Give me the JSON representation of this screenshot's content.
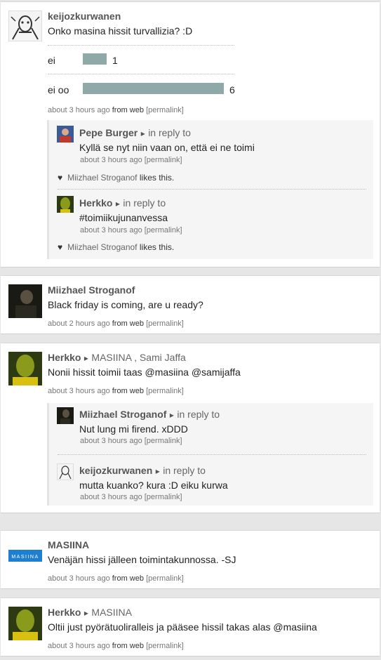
{
  "posts": [
    {
      "author": "keijozkurwanen",
      "text": "Onko masina hissit turvallizia? :D",
      "poll": {
        "options": [
          {
            "label": "ei",
            "count": "1",
            "share": 0.167
          },
          {
            "label": "ei oo",
            "count": "6",
            "share": 1.0
          }
        ]
      },
      "meta": {
        "time": "about 3 hours ago",
        "from": "from web",
        "permalink": "[permalink]"
      },
      "replies": [
        {
          "author": "Pepe Burger",
          "arrow": "▸",
          "in_reply": "in reply to",
          "text": "Kyllä se nyt niin vaan on, että ei ne toimi",
          "time": "about 3 hours ago",
          "permalink": "[permalink]",
          "like_user": "Miizhael Stroganof",
          "likes_word": "likes this."
        },
        {
          "author": "Herkko",
          "arrow": "▸",
          "in_reply": "in reply to",
          "text": "#toimiikujunanvessa",
          "time": "about 3 hours ago",
          "permalink": "[permalink]",
          "like_user": "Miizhael Stroganof",
          "likes_word": "likes this."
        }
      ]
    },
    {
      "author": "Miizhael Stroganof",
      "text": "Black friday is coming, are u ready?",
      "meta": {
        "time": "about 2 hours ago",
        "from": "from web",
        "permalink": "[permalink]"
      }
    },
    {
      "author": "Herkko",
      "arrow": "▸",
      "recipients": "MASIINA , Sami Jaffa",
      "text": "Nonii hissit toimii taas @masiina @samijaffa",
      "meta": {
        "time": "about 3 hours ago",
        "from": "from web",
        "permalink": "[permalink]"
      },
      "replies": [
        {
          "author": "Miizhael Stroganof",
          "arrow": "▸",
          "in_reply": "in reply to",
          "text": "Nut lung mi firend. xDDD",
          "time": "about 3 hours ago",
          "permalink": "[permalink]"
        },
        {
          "author": "keijozkurwanen",
          "arrow": "▸",
          "in_reply": "in reply to",
          "text": "mutta kuanko? kura :D eiku kurwa",
          "time": "about 3 hours ago",
          "permalink": "[permalink]"
        }
      ]
    },
    {
      "author": "MASIINA",
      "logo_text": "MASIINA",
      "text": "Venäjän hissi jälleen toimintakunnossa. -SJ",
      "meta": {
        "time": "about 3 hours ago",
        "from": "from web",
        "permalink": "[permalink]"
      }
    },
    {
      "author": "Herkko",
      "arrow": "▸",
      "recipients": "MASIINA",
      "text": "Oltii just pyörätuoliralleis ja pääsee hissil takas alas @masiina",
      "meta": {
        "time": "about 3 hours ago",
        "from": "from web",
        "permalink": "[permalink]"
      }
    }
  ],
  "colors": {
    "bar": "#8ea9a8",
    "masiina_blue": "#1e7fd0"
  }
}
